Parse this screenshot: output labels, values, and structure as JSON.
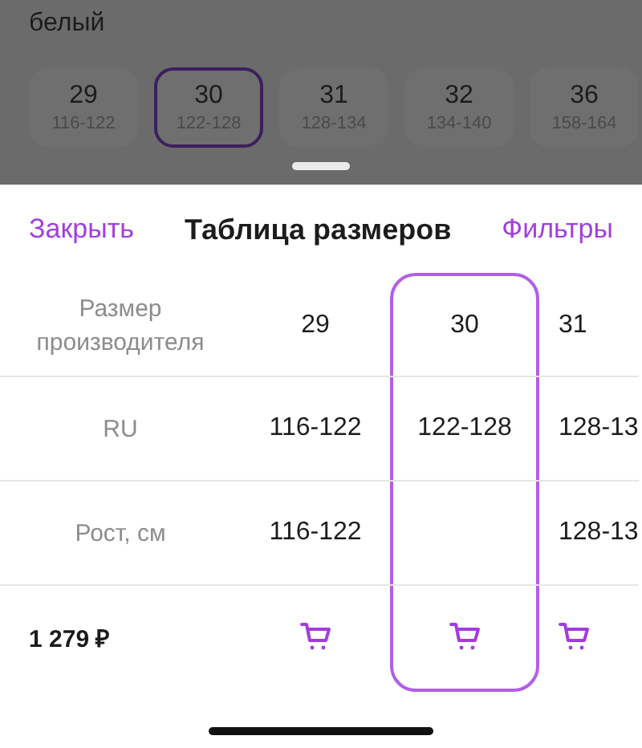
{
  "background": {
    "color_label": "белый",
    "sizes": [
      {
        "size": "29",
        "range": "116-122",
        "selected": false
      },
      {
        "size": "30",
        "range": "122-128",
        "selected": true
      },
      {
        "size": "31",
        "range": "128-134",
        "selected": false
      },
      {
        "size": "32",
        "range": "134-140",
        "selected": false
      },
      {
        "size": "36",
        "range": "158-164",
        "selected": false
      }
    ]
  },
  "sheet": {
    "close": "Закрыть",
    "title": "Таблица размеров",
    "filters": "Фильтры",
    "row_labels": {
      "size": "Размер производителя",
      "ru": "RU",
      "height": "Рост, см"
    },
    "price": "1 279 ₽",
    "columns": [
      {
        "size": "29",
        "ru": "116-122",
        "height": "116-122",
        "selected": false
      },
      {
        "size": "30",
        "ru": "122-128",
        "selected": true
      },
      {
        "size": "31",
        "ru": "128-13",
        "height": "128-13",
        "selected": false
      }
    ]
  }
}
